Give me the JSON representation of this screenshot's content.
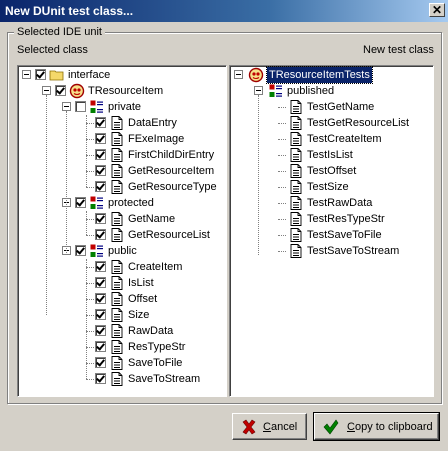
{
  "window": {
    "title": "New DUnit test class..."
  },
  "group": {
    "legend": "Selected IDE unit"
  },
  "left_panel": {
    "label": "Selected class"
  },
  "right_panel": {
    "label": "New test class"
  },
  "left_tree": [
    {
      "label": "interface",
      "icon": "folder-icon",
      "checked": true
    },
    {
      "label": "TResourceItem",
      "icon": "class-icon",
      "checked": true
    },
    {
      "label": "private",
      "icon": "section-icon",
      "checked": false
    },
    {
      "label": "DataEntry",
      "icon": "method-icon",
      "checked": true
    },
    {
      "label": "FExeImage",
      "icon": "method-icon",
      "checked": true
    },
    {
      "label": "FirstChildDirEntry",
      "icon": "method-icon",
      "checked": true
    },
    {
      "label": "GetResourceItem",
      "icon": "method-icon",
      "checked": true
    },
    {
      "label": "GetResourceType",
      "icon": "method-icon",
      "checked": true
    },
    {
      "label": "protected",
      "icon": "section-icon",
      "checked": true
    },
    {
      "label": "GetName",
      "icon": "method-icon",
      "checked": true
    },
    {
      "label": "GetResourceList",
      "icon": "method-icon",
      "checked": true
    },
    {
      "label": "public",
      "icon": "section-icon",
      "checked": true
    },
    {
      "label": "CreateItem",
      "icon": "method-icon",
      "checked": true
    },
    {
      "label": "IsList",
      "icon": "method-icon",
      "checked": true
    },
    {
      "label": "Offset",
      "icon": "method-icon",
      "checked": true
    },
    {
      "label": "Size",
      "icon": "method-icon",
      "checked": true
    },
    {
      "label": "RawData",
      "icon": "method-icon",
      "checked": true
    },
    {
      "label": "ResTypeStr",
      "icon": "method-icon",
      "checked": true
    },
    {
      "label": "SaveToFile",
      "icon": "method-icon",
      "checked": true
    },
    {
      "label": "SaveToStream",
      "icon": "method-icon",
      "checked": true
    }
  ],
  "right_tree": [
    {
      "label": "TResourceItemTests",
      "icon": "class-icon",
      "selected": true
    },
    {
      "label": "published",
      "icon": "section-icon"
    },
    {
      "label": "TestGetName",
      "icon": "method-icon"
    },
    {
      "label": "TestGetResourceList",
      "icon": "method-icon"
    },
    {
      "label": "TestCreateItem",
      "icon": "method-icon"
    },
    {
      "label": "TestIsList",
      "icon": "method-icon"
    },
    {
      "label": "TestOffset",
      "icon": "method-icon"
    },
    {
      "label": "TestSize",
      "icon": "method-icon"
    },
    {
      "label": "TestRawData",
      "icon": "method-icon"
    },
    {
      "label": "TestResTypeStr",
      "icon": "method-icon"
    },
    {
      "label": "TestSaveToFile",
      "icon": "method-icon"
    },
    {
      "label": "TestSaveToStream",
      "icon": "method-icon"
    }
  ],
  "buttons": {
    "cancel": {
      "accel": "C",
      "rest": "ancel",
      "icon": "red-x-icon"
    },
    "copy": {
      "accel": "C",
      "rest": "opy to clipboard",
      "icon": "green-check-icon"
    }
  },
  "colors": {
    "titlebar": "#0a246a",
    "selection": "#0a246a",
    "face": "#d4d0c8"
  }
}
